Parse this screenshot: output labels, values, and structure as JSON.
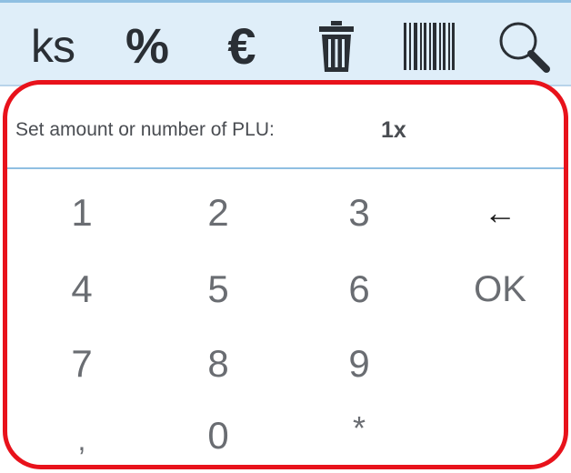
{
  "toolbar": {
    "ks_label": "ks",
    "percent_label": "%",
    "euro_label": "€",
    "icons": [
      "trash-icon",
      "barcode-icon",
      "search-icon"
    ],
    "background": "#dfeef9"
  },
  "prompt": {
    "label": "Set amount or number of PLU:",
    "value": "1x"
  },
  "keypad": {
    "rows": [
      [
        "1",
        "2",
        "3",
        "←"
      ],
      [
        "4",
        "5",
        "6",
        "OK"
      ],
      [
        "7",
        "8",
        "9",
        ""
      ],
      [
        ",",
        "0",
        "*",
        ""
      ]
    ]
  },
  "colors": {
    "highlight_border": "#e8121b",
    "divider": "#8fbfe2",
    "key_text": "#6a6d72"
  }
}
